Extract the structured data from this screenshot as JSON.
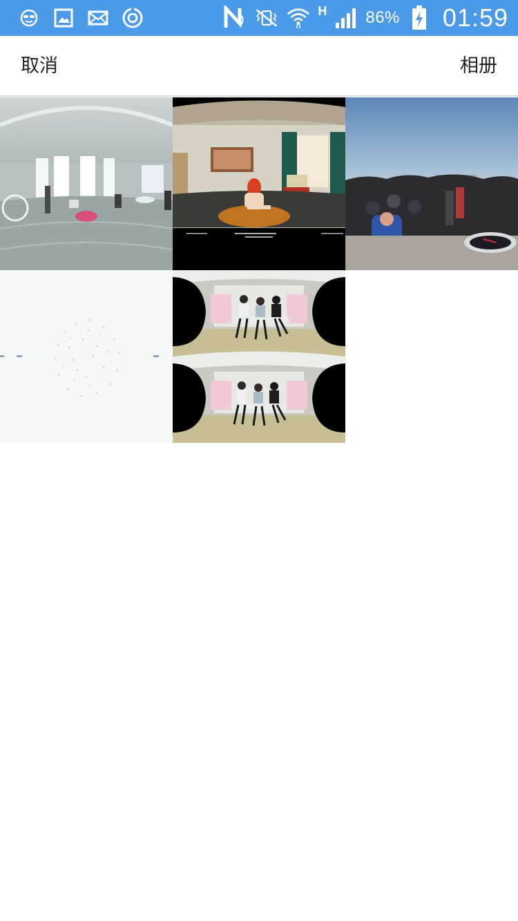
{
  "status_bar": {
    "left_icons": [
      "smiley-glasses-icon",
      "gallery-icon",
      "mail-icon",
      "sync-icon"
    ],
    "right_icons": [
      "nfc-icon",
      "vibrate-icon",
      "wifi-icon",
      "signal-icon",
      "battery-charging-icon"
    ],
    "network_type": "H",
    "battery_percent": "86%",
    "time": "01:59",
    "background_color": "#4b9ae8"
  },
  "title_bar": {
    "cancel_label": "取消",
    "album_label": "相册"
  },
  "grid": {
    "columns": 3,
    "items": [
      {
        "name": "photo-panorama-white-room"
      },
      {
        "name": "photo-panorama-red-hair-girl"
      },
      {
        "name": "photo-panorama-crowd-outdoors"
      },
      {
        "name": "photo-panorama-particles"
      },
      {
        "name": "photo-panorama-three-girls-stereo"
      }
    ]
  }
}
